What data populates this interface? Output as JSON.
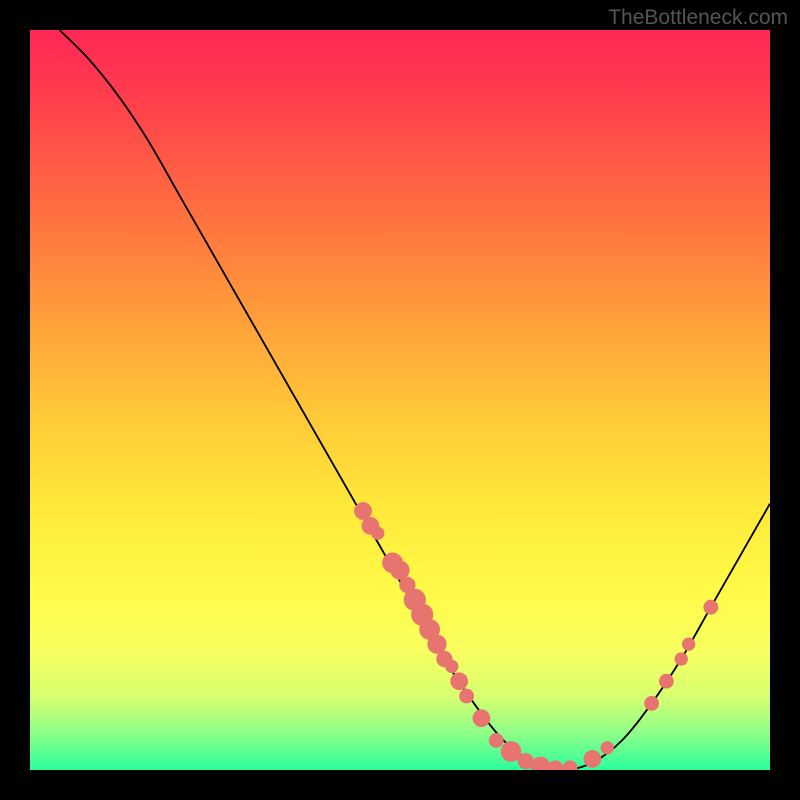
{
  "watermark": "TheBottleneck.com",
  "chart_data": {
    "type": "line",
    "title": "",
    "xlabel": "",
    "ylabel": "",
    "xlim": [
      0,
      100
    ],
    "ylim": [
      0,
      100
    ],
    "curve": [
      {
        "x": 4,
        "y": 100
      },
      {
        "x": 8,
        "y": 96
      },
      {
        "x": 12,
        "y": 91
      },
      {
        "x": 16,
        "y": 85
      },
      {
        "x": 20,
        "y": 78
      },
      {
        "x": 24,
        "y": 71
      },
      {
        "x": 28,
        "y": 64
      },
      {
        "x": 32,
        "y": 57
      },
      {
        "x": 36,
        "y": 50
      },
      {
        "x": 40,
        "y": 43
      },
      {
        "x": 44,
        "y": 36
      },
      {
        "x": 48,
        "y": 29
      },
      {
        "x": 52,
        "y": 22
      },
      {
        "x": 56,
        "y": 15
      },
      {
        "x": 60,
        "y": 9
      },
      {
        "x": 64,
        "y": 4
      },
      {
        "x": 68,
        "y": 1
      },
      {
        "x": 72,
        "y": 0
      },
      {
        "x": 76,
        "y": 1
      },
      {
        "x": 80,
        "y": 4
      },
      {
        "x": 84,
        "y": 9
      },
      {
        "x": 88,
        "y": 15
      },
      {
        "x": 92,
        "y": 22
      },
      {
        "x": 96,
        "y": 29
      },
      {
        "x": 100,
        "y": 36
      }
    ],
    "markers": [
      {
        "x": 45,
        "y": 35,
        "r": 1.2
      },
      {
        "x": 46,
        "y": 33,
        "r": 1.2
      },
      {
        "x": 47,
        "y": 32,
        "r": 0.9
      },
      {
        "x": 49,
        "y": 28,
        "r": 1.4
      },
      {
        "x": 50,
        "y": 27,
        "r": 1.3
      },
      {
        "x": 51,
        "y": 25,
        "r": 1.1
      },
      {
        "x": 52,
        "y": 23,
        "r": 1.5
      },
      {
        "x": 53,
        "y": 21,
        "r": 1.5
      },
      {
        "x": 54,
        "y": 19,
        "r": 1.4
      },
      {
        "x": 55,
        "y": 17,
        "r": 1.3
      },
      {
        "x": 56,
        "y": 15,
        "r": 1.1
      },
      {
        "x": 57,
        "y": 14,
        "r": 0.9
      },
      {
        "x": 58,
        "y": 12,
        "r": 1.2
      },
      {
        "x": 59,
        "y": 10,
        "r": 1.0
      },
      {
        "x": 61,
        "y": 7,
        "r": 1.2
      },
      {
        "x": 63,
        "y": 4,
        "r": 1.0
      },
      {
        "x": 65,
        "y": 2.5,
        "r": 1.4
      },
      {
        "x": 67,
        "y": 1.2,
        "r": 1.1
      },
      {
        "x": 69,
        "y": 0.5,
        "r": 1.3
      },
      {
        "x": 71,
        "y": 0.2,
        "r": 1.1
      },
      {
        "x": 73,
        "y": 0.3,
        "r": 1.0
      },
      {
        "x": 76,
        "y": 1.5,
        "r": 1.2
      },
      {
        "x": 78,
        "y": 3,
        "r": 0.9
      },
      {
        "x": 84,
        "y": 9,
        "r": 1.0
      },
      {
        "x": 86,
        "y": 12,
        "r": 1.0
      },
      {
        "x": 88,
        "y": 15,
        "r": 0.9
      },
      {
        "x": 89,
        "y": 17,
        "r": 0.9
      },
      {
        "x": 92,
        "y": 22,
        "r": 1.0
      }
    ],
    "marker_color": "#e8746f",
    "curve_color": "#000000"
  }
}
